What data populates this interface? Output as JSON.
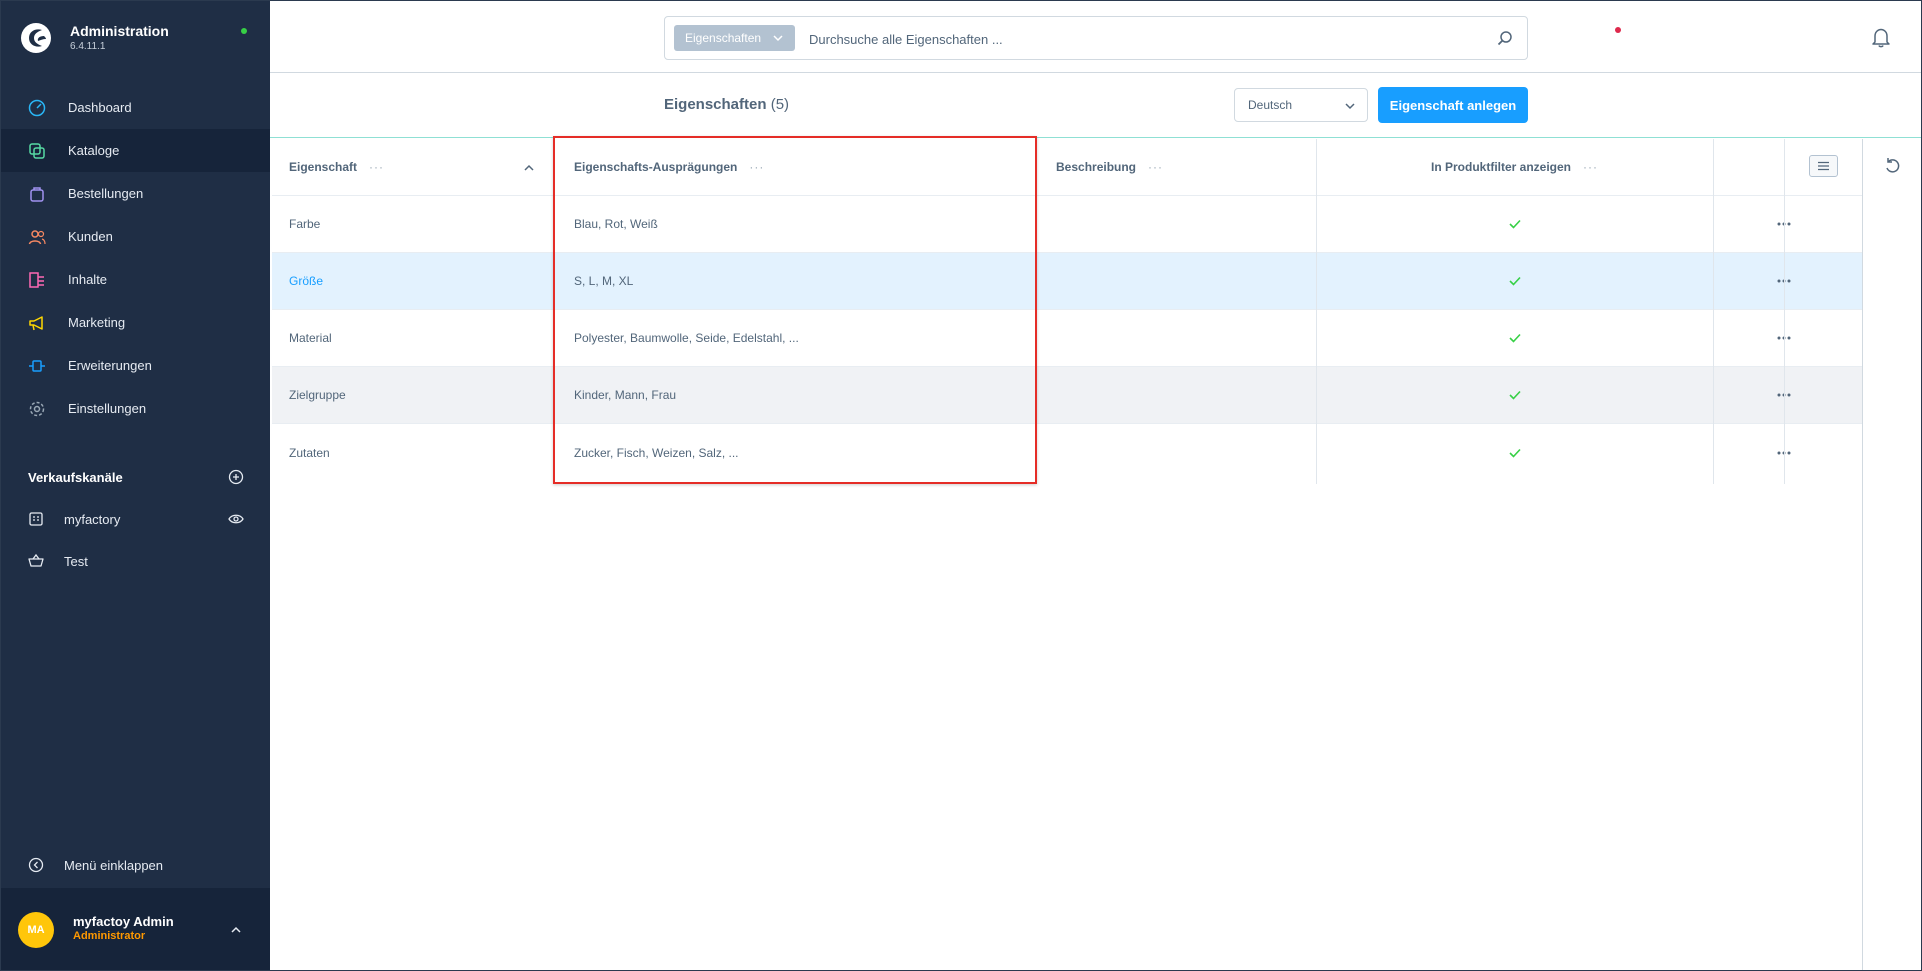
{
  "app": {
    "title": "Administration",
    "version": "6.4.11.1"
  },
  "sidebar": {
    "nav": [
      {
        "label": "Dashboard",
        "icon": "dashboard-icon",
        "color": "#29b6f6"
      },
      {
        "label": "Kataloge",
        "icon": "catalog-icon",
        "color": "#57d9a3"
      },
      {
        "label": "Bestellungen",
        "icon": "bag-icon",
        "color": "#a092f0"
      },
      {
        "label": "Kunden",
        "icon": "users-icon",
        "color": "#f88962"
      },
      {
        "label": "Inhalte",
        "icon": "content-icon",
        "color": "#ff68b4"
      },
      {
        "label": "Marketing",
        "icon": "megaphone-icon",
        "color": "#ffd700"
      },
      {
        "label": "Erweiterungen",
        "icon": "plugin-icon",
        "color": "#189eff"
      },
      {
        "label": "Einstellungen",
        "icon": "gear-icon",
        "color": "#9aa8b5"
      }
    ],
    "sales_channels_title": "Verkaufskanäle",
    "sales_channels": [
      {
        "label": "myfactory"
      },
      {
        "label": "Test"
      }
    ],
    "collapse_label": "Menü einklappen"
  },
  "user": {
    "initials": "MA",
    "name": "myfactoy Admin",
    "role": "Administrator"
  },
  "search": {
    "type_label": "Eigenschaften",
    "placeholder": "Durchsuche alle Eigenschaften ..."
  },
  "smartbar": {
    "title": "Eigenschaften",
    "count": "(5)",
    "language": "Deutsch",
    "create_button": "Eigenschaft anlegen"
  },
  "table": {
    "columns": [
      "Eigenschaft",
      "Eigenschafts-Ausprägungen",
      "Beschreibung",
      "In Produktfilter anzeigen"
    ],
    "rows": [
      {
        "name": "Farbe",
        "values": "Blau, Rot, Weiß",
        "description": "",
        "in_filter": true
      },
      {
        "name": "Größe",
        "values": "S, L, M, XL",
        "description": "",
        "in_filter": true
      },
      {
        "name": "Material",
        "values": "Polyester, Baumwolle, Seide, Edelstahl, ...",
        "description": "",
        "in_filter": true
      },
      {
        "name": "Zielgruppe",
        "values": "Kinder, Mann, Frau",
        "description": "",
        "in_filter": true
      },
      {
        "name": "Zutaten",
        "values": "Zucker, Fisch, Weizen, Salz, ...",
        "description": "",
        "in_filter": true
      }
    ]
  },
  "colors": {
    "sidebar": "#1f2e45",
    "primary": "#189eff",
    "success": "#37d046",
    "highlight": "#e52d27"
  }
}
